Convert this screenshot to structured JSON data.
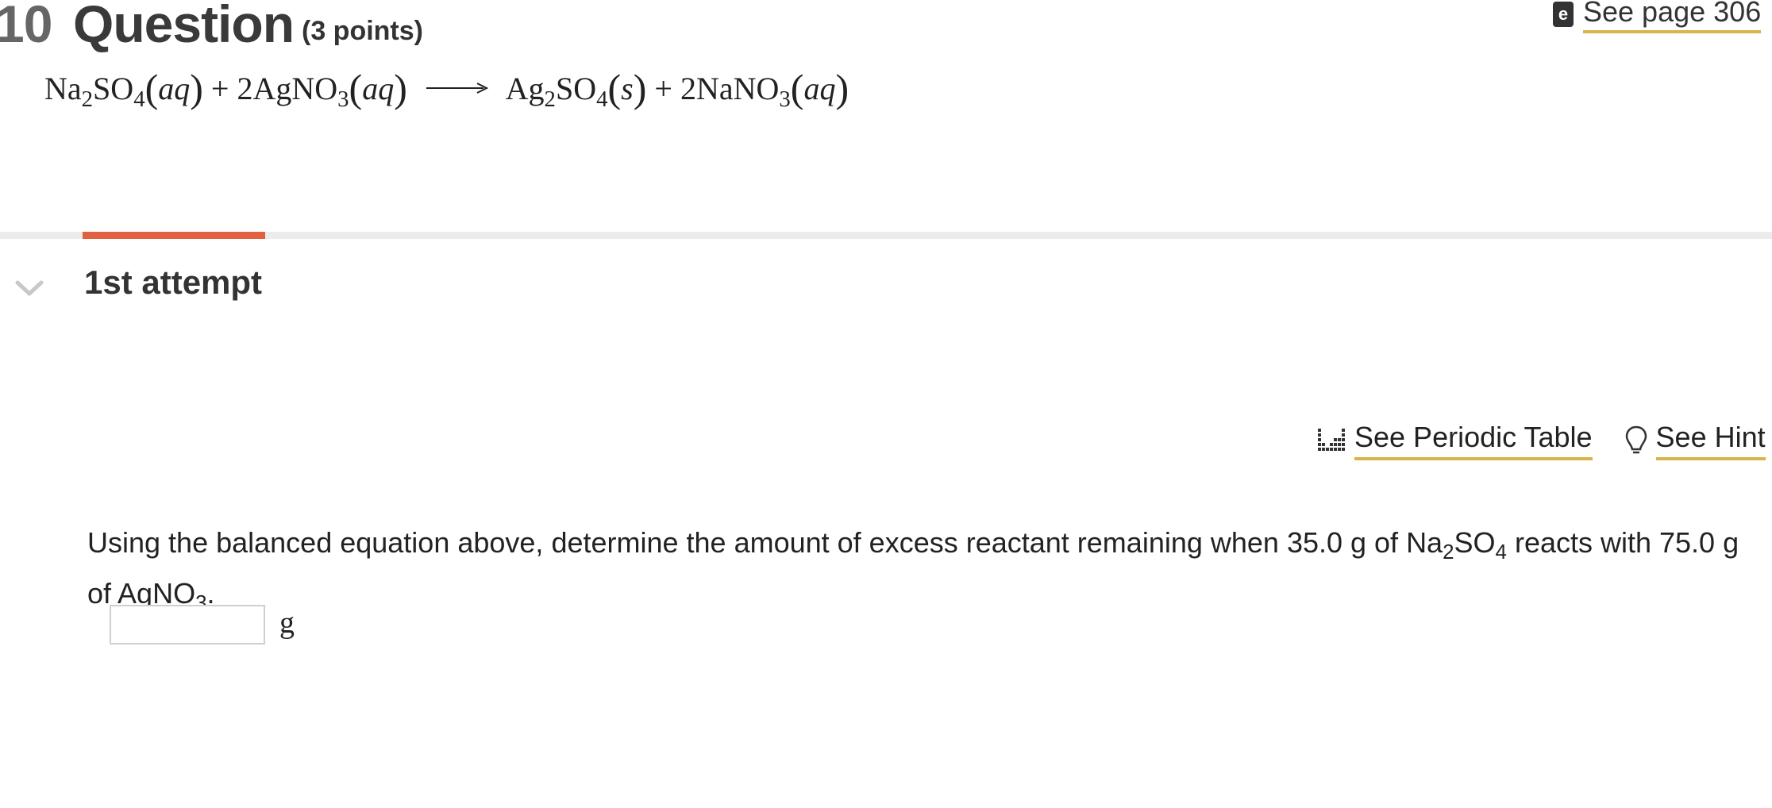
{
  "question": {
    "number": "10",
    "word": "Question",
    "points": "(3 points)"
  },
  "ebook_link": {
    "icon": "e",
    "label": "See page 306"
  },
  "equation": {
    "reactant1": {
      "base": "Na",
      "sub1": "2",
      "mid": "SO",
      "sub2": "4",
      "state": "aq"
    },
    "plus1": "+",
    "reactant2": {
      "coef": "2",
      "base": "AgNO",
      "sub": "3",
      "state": "aq"
    },
    "product1": {
      "base": "Ag",
      "sub1": "2",
      "mid": "SO",
      "sub2": "4",
      "state": "s"
    },
    "plus2": "+",
    "product2": {
      "coef": "2",
      "base": "NaNO",
      "sub": "3",
      "state": "aq"
    }
  },
  "attempt": {
    "label": "1st attempt",
    "progress_fraction": 0.1
  },
  "tools": {
    "periodic_table_label": "See Periodic Table",
    "hint_label": "See Hint"
  },
  "prompt": {
    "text_before": "Using the balanced equation above, determine the amount of excess reactant remaining when 35.0 g of Na",
    "na_sub": "2",
    "so": "SO",
    "so_sub": "4",
    "text_mid": " reacts with 75.0 g of AgNO",
    "ag_sub": "3",
    "text_end": "."
  },
  "answer": {
    "value": "",
    "unit": "g"
  },
  "colors": {
    "accent_underline": "#d9b44a",
    "progress": "#e0603f"
  }
}
